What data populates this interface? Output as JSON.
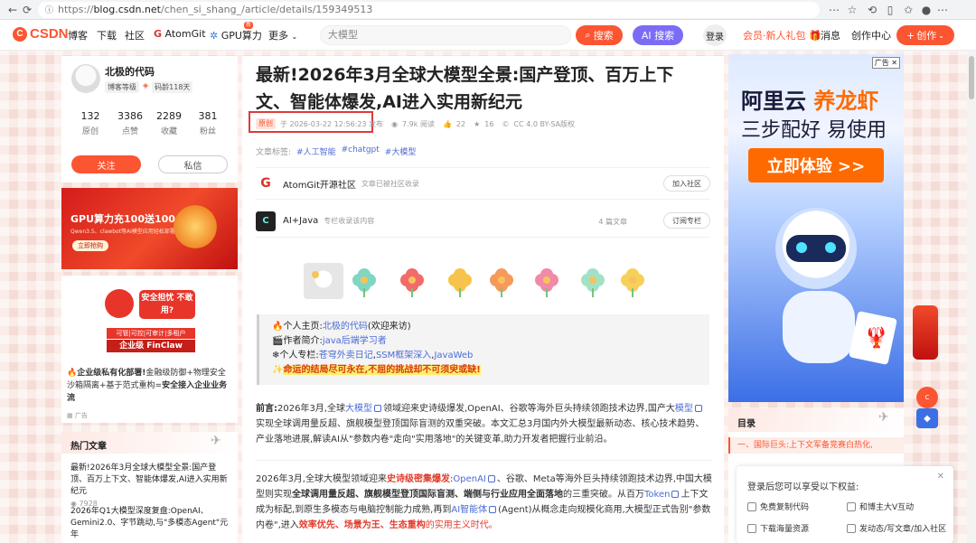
{
  "browser": {
    "url_scheme": "https://",
    "url_domain": "blog.csdn.net",
    "url_path": "/chen_si_shang_/article/details/159349513"
  },
  "nav": {
    "logo": "CSDN",
    "items": [
      "博客",
      "下载",
      "社区",
      "AtomGit",
      "GPU算力",
      "更多"
    ],
    "gpu_badge": "新",
    "search_placeholder": "大模型",
    "search_btn": "搜索",
    "ai_search_btn": "AI 搜索",
    "login": "登录",
    "member": "会员·新人礼包",
    "messages": "消息",
    "creator": "创作中心",
    "create_btn": "创作"
  },
  "profile": {
    "name": "北极的代码",
    "level_label": "博客等级",
    "age": "码龄118天",
    "stats": [
      {
        "num": "132",
        "label": "原创"
      },
      {
        "num": "3386",
        "label": "点赞"
      },
      {
        "num": "2289",
        "label": "收藏"
      },
      {
        "num": "381",
        "label": "粉丝"
      }
    ],
    "follow": "关注",
    "message": "私信"
  },
  "gpu_ad": {
    "title": "GPU算力充100送100",
    "sub": "Qwen3.5、clawbot等AI模型应用轻松部署",
    "btn": "立即抢购"
  },
  "finclaw_ad": {
    "bubble": "安全担忧 不敢用?",
    "tags": "可管|可控|可审计|多租户",
    "name": "企业级 FinClaw",
    "text_bold": "企业级私有化部署!",
    "text_mid": "金融级防御+物理安全沙箱隔离+基于范式重构=",
    "text_bold2": "安全接入企业业务流",
    "ad_label": "广告"
  },
  "hot": {
    "title": "热门文章",
    "items": [
      {
        "text": "最新!2026年3月全球大模型全景:国产登顶、百万上下文、智能体爆发,AI进入实用新纪元",
        "views": "7928"
      },
      {
        "text": "2026年Q1大模型深度复盘:OpenAI、Gemini2.0、字节跳动,与\"多模态Agent\"元年",
        "views": "5180"
      }
    ]
  },
  "article": {
    "title": "最新!2026年3月全球大模型全景:国产登顶、百万上下文、智能体爆发,AI进入实用新纪元",
    "original_badge": "原创",
    "published": "于 2026-03-22 12:56:23 发布",
    "views": "7.9k 阅读",
    "likes": "22",
    "favorites": "16",
    "license": "CC 4.0 BY-SA版权",
    "tags_label": "文章标签:",
    "tags": [
      "#人工智能",
      "#chatgpt",
      "#大模型"
    ],
    "communities": [
      {
        "name": "AtomGit开源社区",
        "desc": "文章已被社区收录",
        "btn": "加入社区"
      },
      {
        "name": "AI+Java",
        "desc": "专栏收录该内容",
        "count": "4 篇文章",
        "btn": "订阅专栏"
      }
    ],
    "intro": {
      "home_label": "个人主页:",
      "home_link": "北极的代码",
      "home_suffix": "(欢迎来访)",
      "author_label": "作者简介:",
      "author_value": "java后端学习者",
      "column_label": "个人专栏:",
      "column_1": "苍穹外卖日记",
      "column_2": "SSM框架深入",
      "column_3": "JavaWeb",
      "motto": "命运的结局尽可永在,不屈的挑战却不可须臾或缺!"
    },
    "preface": {
      "label": "前言:",
      "p1": "2026年3月,全球",
      "l1": "大模型",
      "p2": "领域迎来史诗级爆发,OpenAI、谷歌等海外巨头持续领跑技术边界,国产大",
      "l2": "模型",
      "p3": "实现全球调用量反超、旗舰模型登顶国际盲测的双重突破。本文汇总3月国内外大模型最新动态、核心技术趋势、产业落地进展,解读AI从\"参数内卷\"走向\"实用落地\"的关键变革,助力开发者把握行业前沿。"
    },
    "para2": {
      "s1": "2026年3月,全球大模型领域迎来",
      "r1": "史诗级密集爆发",
      "s2": ":",
      "l1": "OpenAI",
      "s3": "、谷歌、Meta等海外巨头持续领跑技术边界,中国大模型则实现",
      "b1": "全球调用量反超、旗舰模型登顶国际盲测、端侧与行业应用全面落地",
      "s4": "的三重突破。从百万",
      "l2": "Token",
      "s5": "上下文成为标配,到原生多模态与电脑控制能力成熟,再到",
      "l3": "AI智能体",
      "s6": "(Agent)从概念走向规模化商用,大模型正式告别\"参数内卷\",进入",
      "r2": "效率优先、场景为王、生态重构",
      "r3": "的实用主义时代。"
    }
  },
  "right_ad": {
    "badge": "广告",
    "line1a": "阿里云",
    "line1b": "养龙虾",
    "line2": "三步配好 易使用",
    "btn": "立即体验 >>"
  },
  "toc": {
    "title": "目录",
    "item": "一、国际巨头:上下文军备竞赛白热化,"
  },
  "login_panel": {
    "title": "登录后您可以享受以下权益:",
    "perks": [
      "免费复制代码",
      "和博主大V互动",
      "下载海量资源",
      "发动态/写文章/加入社区"
    ]
  },
  "colors": {
    "brand": "#fc5531",
    "link": "#4a6bd6",
    "ai": "#7b6cf6"
  }
}
